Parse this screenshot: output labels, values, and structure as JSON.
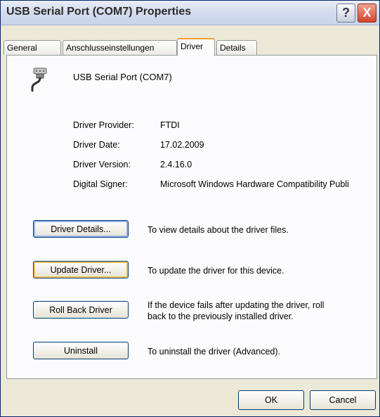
{
  "window": {
    "title": "USB Serial Port (COM7) Properties",
    "help_label": "?",
    "close_label": "X"
  },
  "tabs": [
    {
      "label": "General"
    },
    {
      "label": "Anschlusseinstellungen"
    },
    {
      "label": "Driver",
      "active": true
    },
    {
      "label": "Details"
    }
  ],
  "device": {
    "name": "USB Serial Port (COM7)",
    "icon": "serial-port-icon"
  },
  "driver_info": [
    {
      "label": "Driver Provider:",
      "value": "FTDI"
    },
    {
      "label": "Driver Date:",
      "value": "17.02.2009"
    },
    {
      "label": "Driver Version:",
      "value": "2.4.16.0"
    },
    {
      "label": "Digital Signer:",
      "value": "Microsoft Windows Hardware Compatibility Publi"
    }
  ],
  "actions": [
    {
      "button": "Driver Details...",
      "description": "To view details about the driver files."
    },
    {
      "button": "Update Driver...",
      "description": "To update the driver for this device."
    },
    {
      "button": "Roll Back Driver",
      "description_line1": "If the device fails after updating the driver, roll",
      "description_line2": "back to the previously installed driver."
    },
    {
      "button": "Uninstall",
      "description": "To uninstall the driver (Advanced)."
    }
  ],
  "footer": {
    "ok_label": "OK",
    "cancel_label": "Cancel"
  }
}
